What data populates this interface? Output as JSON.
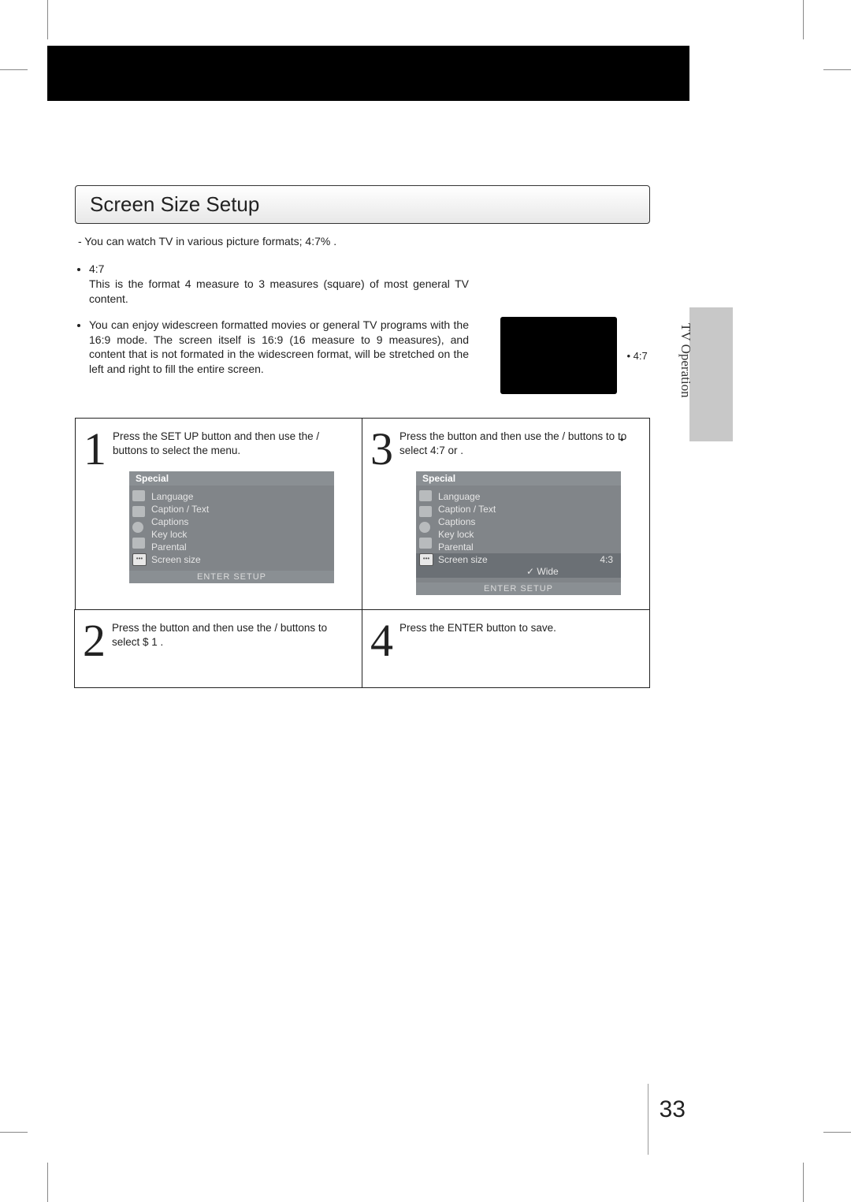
{
  "side_label": "TV Operation",
  "title": "Screen Size Setup",
  "intro": "- You can watch TV in various picture formats; 4:7%       .",
  "formats": {
    "a_label": "4:7",
    "a_desc": "This is the format 4 measure to 3 measures (square) of most general TV content.",
    "b_label": "",
    "b_desc": "You can enjoy widescreen formatted movies or general TV programs with the 16:9 mode. The screen itself is 16:9 (16 measure to 9 measures), and content that is not formated in the widescreen format, will be stretched on the left and right to fill the entire screen."
  },
  "tv": {
    "label_a": "4:7",
    "label_b": ""
  },
  "steps": {
    "s1": {
      "num": "1",
      "line": "Press the SET UP button and then use the      /       buttons to select the               menu."
    },
    "s2": {
      "num": "2",
      "line": "Press the        button and then use the      /       buttons to select       $ 1         ."
    },
    "s3": {
      "num": "3",
      "line": "Press the        button and then use the      /       buttons to to select 4:7  or           ."
    },
    "s4": {
      "num": "4",
      "line": "Press the ENTER button to save."
    }
  },
  "osd": {
    "header": "Special",
    "items": [
      "Language",
      "Caption / Text",
      "Captions",
      "Key lock",
      "Parental",
      "Screen size"
    ],
    "footer": "ENTER   SETUP",
    "opt_a": "4:3",
    "opt_b": "✓ Wide"
  },
  "page_number": "33"
}
